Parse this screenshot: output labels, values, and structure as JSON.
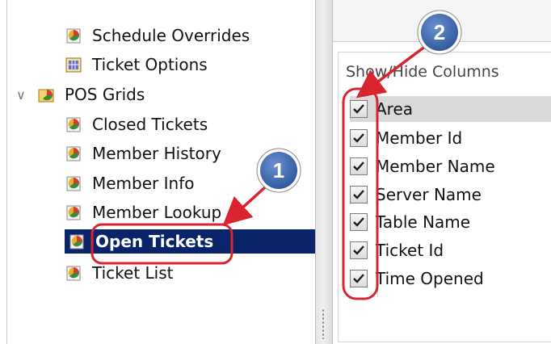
{
  "tree": {
    "items": [
      {
        "label": "Schedule Overrides",
        "icon": "report-icon"
      },
      {
        "label": "Ticket Options",
        "icon": "grid-icon"
      },
      {
        "label": "POS Grids",
        "icon": "folder-report-icon"
      },
      {
        "label": "Closed Tickets",
        "icon": "report-icon"
      },
      {
        "label": "Member History",
        "icon": "report-icon"
      },
      {
        "label": "Member Info",
        "icon": "report-icon"
      },
      {
        "label": "Member Lookup",
        "icon": "report-icon"
      },
      {
        "label": "Open Tickets",
        "icon": "report-icon",
        "selected": true
      },
      {
        "label": "Ticket List",
        "icon": "report-icon"
      }
    ]
  },
  "panel": {
    "group_title": "Show/Hide Columns",
    "columns": [
      {
        "label": "Area",
        "checked": true
      },
      {
        "label": "Member Id",
        "checked": true
      },
      {
        "label": "Member Name",
        "checked": true
      },
      {
        "label": "Server Name",
        "checked": true
      },
      {
        "label": "Table Name",
        "checked": true
      },
      {
        "label": "Ticket Id",
        "checked": true
      },
      {
        "label": "Time Opened",
        "checked": true
      }
    ]
  },
  "callouts": [
    {
      "number": "1"
    },
    {
      "number": "2"
    }
  ],
  "colors": {
    "selection": "#0a246a",
    "callout_fill": "#3b63a8",
    "annotation_red": "#d9232e"
  }
}
